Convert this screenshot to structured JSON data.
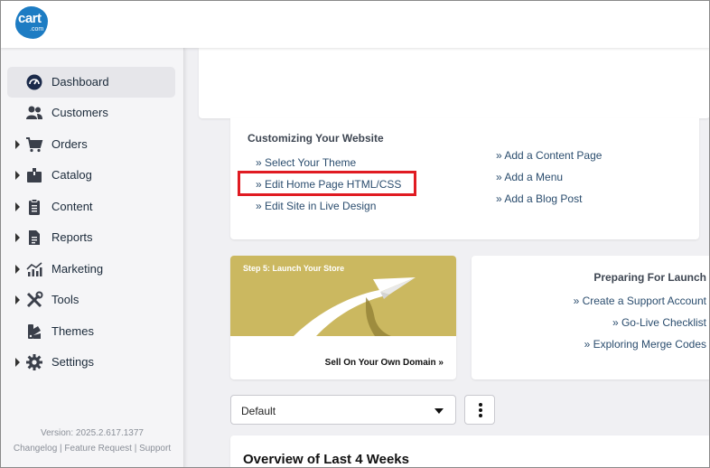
{
  "logo": {
    "text": "cart",
    "suffix": ".com"
  },
  "sidebar": {
    "items": [
      {
        "label": "Dashboard",
        "icon": "dashboard-icon",
        "active": true,
        "expandable": false
      },
      {
        "label": "Customers",
        "icon": "customers-icon",
        "active": false,
        "expandable": false
      },
      {
        "label": "Orders",
        "icon": "cart-icon",
        "active": false,
        "expandable": true
      },
      {
        "label": "Catalog",
        "icon": "box-icon",
        "active": false,
        "expandable": true
      },
      {
        "label": "Content",
        "icon": "clipboard-icon",
        "active": false,
        "expandable": true
      },
      {
        "label": "Reports",
        "icon": "document-icon",
        "active": false,
        "expandable": true
      },
      {
        "label": "Marketing",
        "icon": "chart-icon",
        "active": false,
        "expandable": true
      },
      {
        "label": "Tools",
        "icon": "tools-icon",
        "active": false,
        "expandable": true
      },
      {
        "label": "Themes",
        "icon": "palette-icon",
        "active": false,
        "expandable": false
      },
      {
        "label": "Settings",
        "icon": "gear-icon",
        "active": false,
        "expandable": true
      }
    ],
    "version": "Version: 2025.2.617.1377",
    "links": [
      "Changelog",
      "Feature Request",
      "Support"
    ],
    "link_separator": " | "
  },
  "customize": {
    "title": "Customizing Your Website",
    "left_links": [
      "» Select Your Theme",
      "» Edit Home Page HTML/CSS",
      "» Edit Site in Live Design"
    ],
    "right_links": [
      "» Add a Content Page",
      "» Add a Menu",
      "» Add a Blog Post"
    ]
  },
  "step": {
    "title": "Step 5: Launch Your Store",
    "cta": "Sell On Your Own Domain »"
  },
  "launch": {
    "title": "Preparing For Launch",
    "links": [
      "» Create a Support Account",
      "» Go-Live Checklist",
      "» Exploring Merge Codes"
    ]
  },
  "dashboard_select": {
    "value": "Default"
  },
  "overview": {
    "title": "Overview of Last 4 Weeks"
  },
  "colors": {
    "accent": "#1d7cc3",
    "link": "#2b4d6e",
    "highlight": "#e01b22",
    "banner": "#cbb860"
  }
}
